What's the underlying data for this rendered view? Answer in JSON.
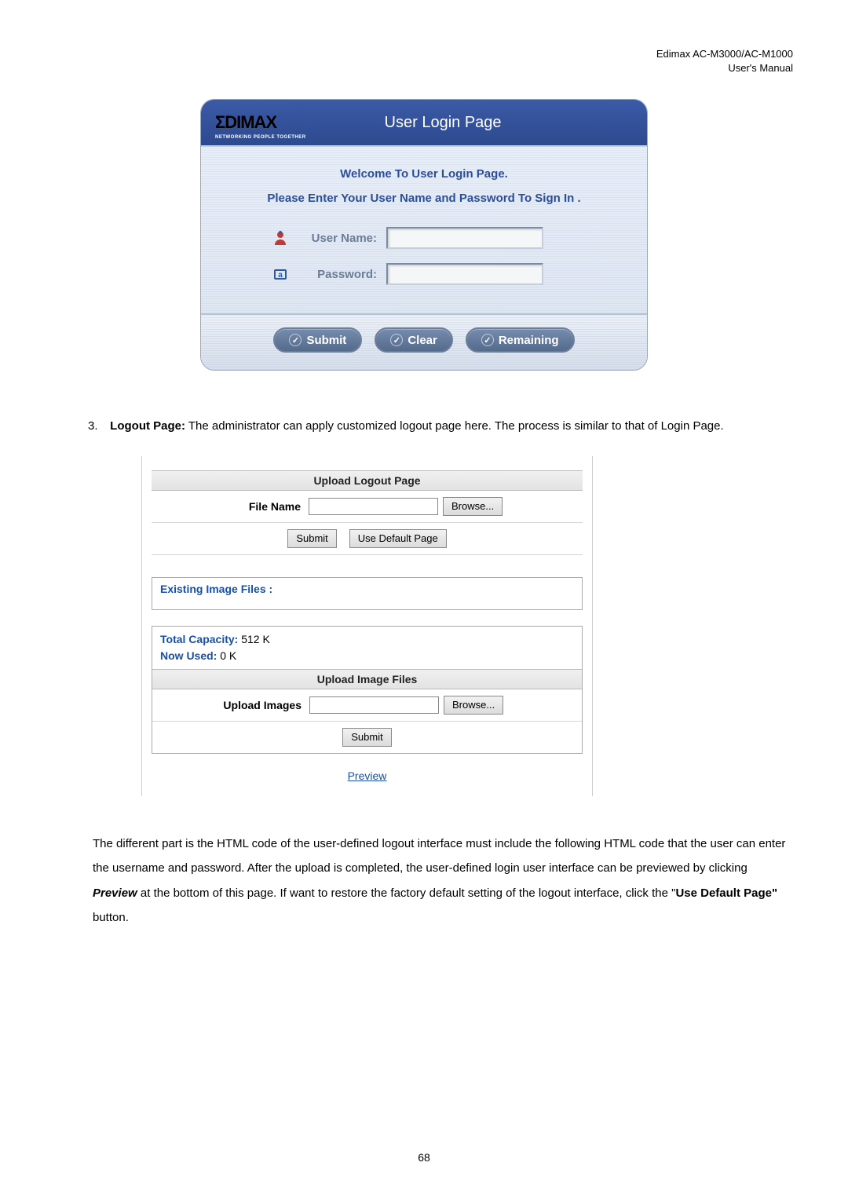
{
  "header": {
    "line1": "Edimax  AC-M3000/AC-M1000",
    "line2": "User's  Manual"
  },
  "login": {
    "logo_text": "ΣDIMAX",
    "logo_tagline": "NETWORKING PEOPLE TOGETHER",
    "title": "User Login Page",
    "welcome": "Welcome To User Login Page.",
    "instruction": "Please Enter Your User Name and Password To Sign In .",
    "username_label": "User Name:",
    "password_label": "Password:",
    "submit": "Submit",
    "clear": "Clear",
    "remaining": "Remaining"
  },
  "list": {
    "num": "3.",
    "title": "Logout Page:",
    "text_after": " The administrator can apply customized logout page here. The process is similar to that of Login Page."
  },
  "upload": {
    "section1": "Upload Logout Page",
    "file_name_label": "File Name",
    "browse": "Browse...",
    "submit": "Submit",
    "use_default": "Use Default Page",
    "existing_title": "Existing Image Files :",
    "total_capacity_label": "Total Capacity: ",
    "total_capacity_value": "512 K",
    "now_used_label": "Now Used: ",
    "now_used_value": "0 K",
    "section2": "Upload Image Files",
    "upload_images_label": "Upload Images",
    "preview": "Preview "
  },
  "para2": {
    "p1a": "The different part is the HTML code of the user-defined logout interface must include the following HTML code that the user can enter the username and password. After the upload is completed, the user-defined login user interface can be previewed by clicking ",
    "preview": "Preview",
    "p1b": " at the bottom of this page. If want to restore the factory default setting of the logout interface, click the \"",
    "use_default": "Use Default Page\"",
    "p1c": " button."
  },
  "page_number": "68"
}
